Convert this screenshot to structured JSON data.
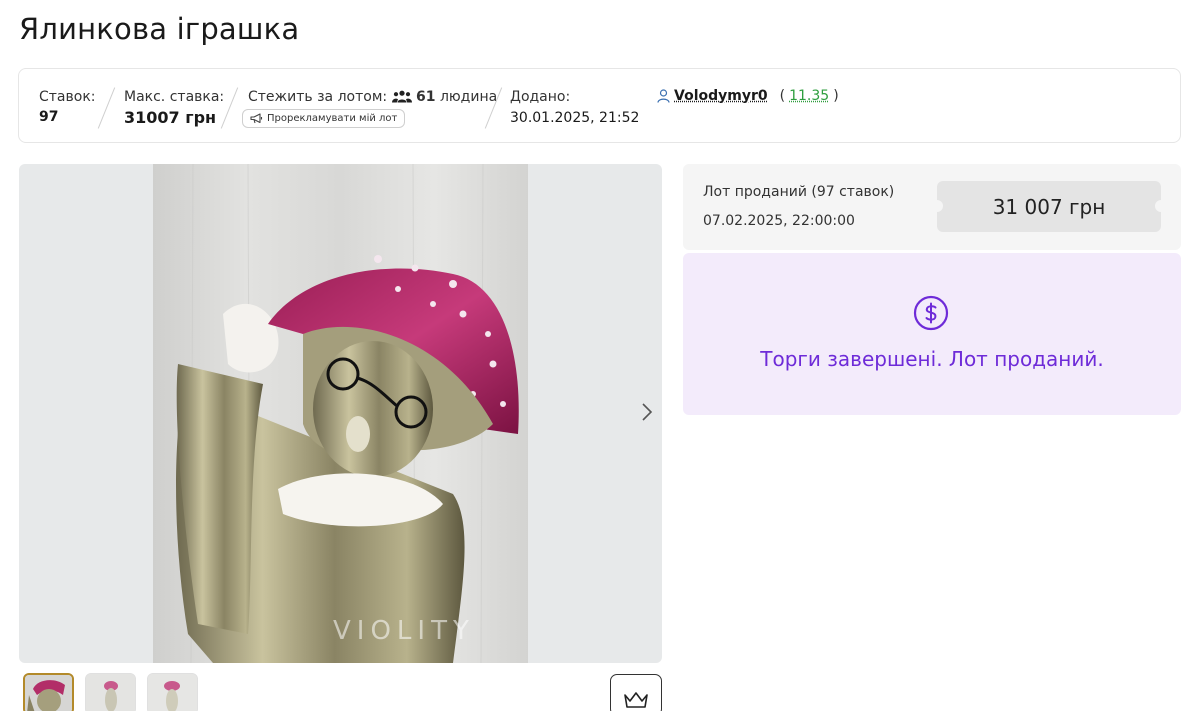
{
  "page": {
    "title": "Ялинкова іграшка"
  },
  "info": {
    "bids_label": "Ставок:",
    "bids_value": "97",
    "max_bid_label": "Макс. ставка:",
    "max_bid_value": "31007 грн",
    "watchers_label": "Стежить за лотом:",
    "watchers_count": "61",
    "watchers_unit": "людина",
    "promote_label": "Прорекламувати мій лот",
    "added_label": "Додано:",
    "added_value": "30.01.2025, 21:52",
    "seller_name": "Volodymyr0",
    "seller_rating": "11.35",
    "rating_open": "(",
    "rating_close": ")"
  },
  "sale": {
    "status_line": "Лот проданий (97 ставок)",
    "end_time": "07.02.2025, 22:00:00",
    "price": "31 007 грн"
  },
  "ended": {
    "message": "Торги завершені. Лот проданий."
  },
  "gallery": {
    "watermark": "VIOLITY",
    "next_icon": "chevron-right-icon",
    "thumbnail_count": 3,
    "active_thumbnail": 1
  },
  "icons": {
    "people": "people-icon",
    "megaphone": "megaphone-icon",
    "user": "user-icon",
    "dollar": "dollar-circle-icon",
    "crown": "crown-icon"
  },
  "colors": {
    "accent_purple": "#6e2bd8",
    "ended_bg": "#f3ebfb",
    "rating_green": "#2e9e3e",
    "thumb_active_border": "#b38a2a"
  }
}
